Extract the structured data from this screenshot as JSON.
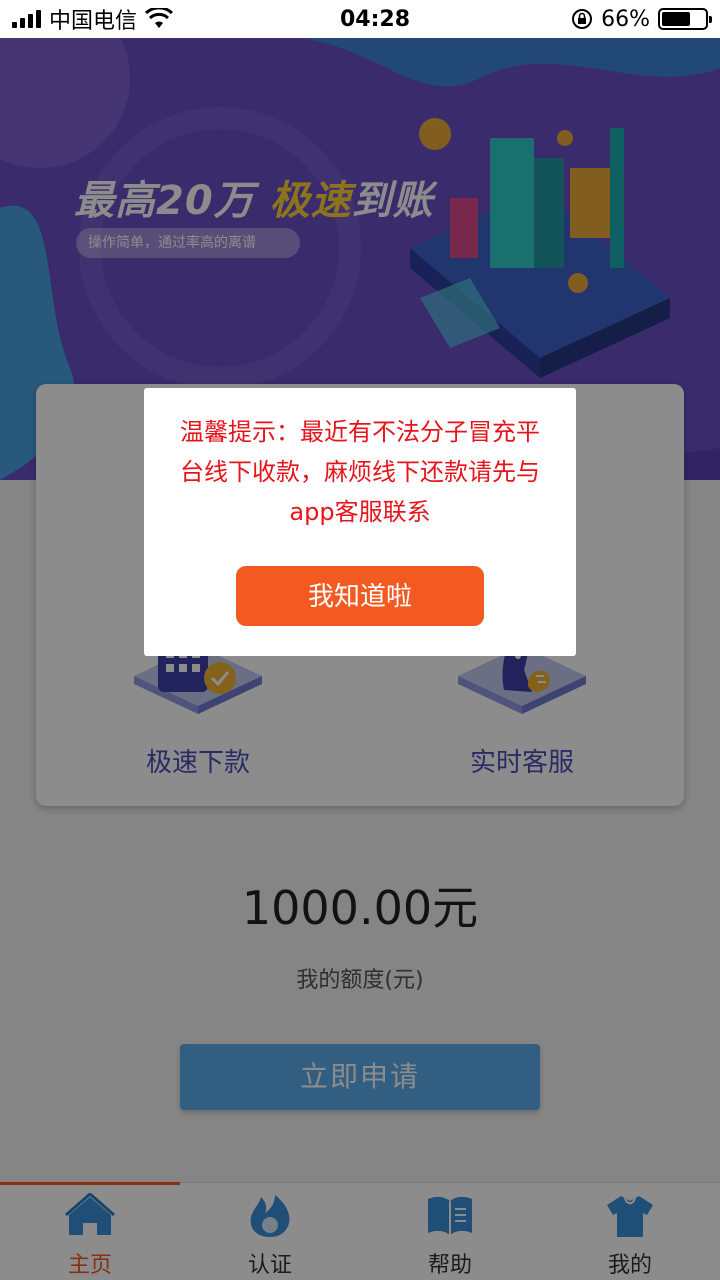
{
  "status_bar": {
    "carrier": "中国电信",
    "time": "04:28",
    "battery_percent": "66%",
    "battery_level": 0.66
  },
  "banner": {
    "title_main": "最高20万",
    "title_accent": "极速",
    "title_tail": "到账",
    "subtitle": "操作简单，通过率高的离谱"
  },
  "features": [
    {
      "label": "极速下款",
      "icon": "calendar-check-icon"
    },
    {
      "label": "实时客服",
      "icon": "customer-service-icon"
    }
  ],
  "credit": {
    "amount": "1000.00元",
    "label": "我的额度(元)"
  },
  "apply_button": "立即申请",
  "tabs": [
    {
      "label": "主页",
      "icon": "home-icon",
      "active": true
    },
    {
      "label": "认证",
      "icon": "flame-icon",
      "active": false
    },
    {
      "label": "帮助",
      "icon": "book-icon",
      "active": false
    },
    {
      "label": "我的",
      "icon": "shirt-icon",
      "active": false
    }
  ],
  "dialog": {
    "message": "温馨提示：最近有不法分子冒充平台线下收款，麻烦线下还款请先与app客服联系",
    "button": "我知道啦"
  },
  "colors": {
    "accent": "#f35a22",
    "banner": "#6b4fc7",
    "apply": "#5aacec",
    "warning_text": "#e8141b",
    "feature_text": "#4d4fb8"
  }
}
